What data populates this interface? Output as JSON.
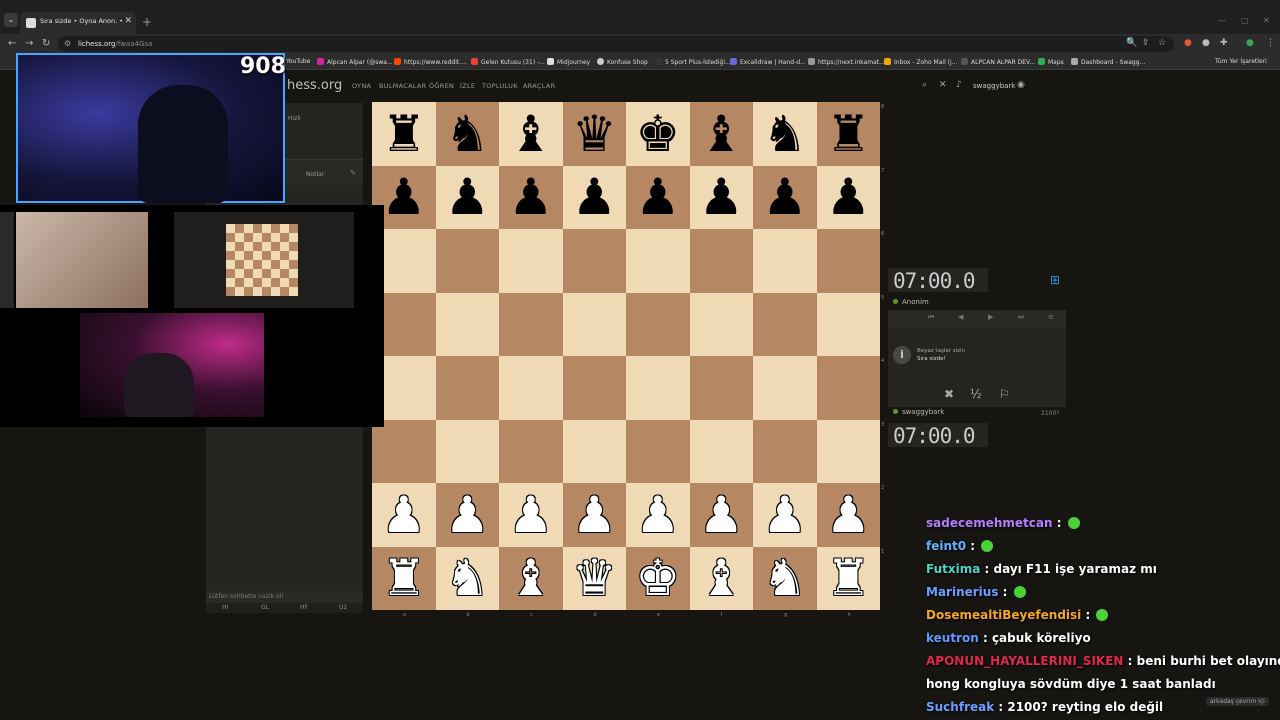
{
  "browser": {
    "tab_title": "Sıra sizde • Oyna Anon. • liches",
    "url_host": "lichess.org",
    "url_path": "/fwaa4Gsa",
    "bookmarks": [
      "YouTube",
      "Alpcan Alpar (@swa...",
      "https://www.reddit....",
      "Gelen Kutusu (31) -...",
      "Midjourney",
      "Konfuse Shop",
      "5 Sport Plus-İstediği...",
      "Excalidraw | Hand-d...",
      "https://next.inkamat...",
      "Inbox - Zoho Mail (j...",
      "ALPCAN ALPAR DEV...",
      "Maps",
      "Dashboard - Swagg..."
    ],
    "all_bookmarks": "Tüm Yer İşaretleri"
  },
  "site": {
    "logo": "hess.org",
    "nav": [
      "OYNA",
      "BULMACALAR",
      "ÖĞREN",
      "İZLE",
      "TOPLULUK",
      "ARAÇLAR"
    ],
    "username": "swaggybark",
    "mode_label": "Hızlı",
    "notes_label": "Notlar",
    "chat_placeholder": "Lütfen sohbette nazik ol!",
    "chat_presets": [
      "HI",
      "GL",
      "HF",
      "U2"
    ]
  },
  "board": {
    "rows": [
      [
        "♜",
        "♞",
        "♝",
        "♛",
        "♚",
        "♝",
        "♞",
        "♜"
      ],
      [
        "♟",
        "♟",
        "♟",
        "♟",
        "♟",
        "♟",
        "♟",
        "♟"
      ],
      [
        "",
        "",
        "",
        "",
        "",
        "",
        "",
        ""
      ],
      [
        "",
        "",
        "",
        "",
        "",
        "",
        "",
        ""
      ],
      [
        "",
        "",
        "",
        "",
        "",
        "",
        "",
        ""
      ],
      [
        "",
        "",
        "",
        "",
        "",
        "",
        "",
        ""
      ],
      [
        "♟",
        "♟",
        "♟",
        "♟",
        "♟",
        "♟",
        "♟",
        "♟"
      ],
      [
        "♜",
        "♞",
        "♝",
        "♛",
        "♚",
        "♝",
        "♞",
        "♜"
      ]
    ],
    "ranks": [
      "8",
      "7",
      "6",
      "5",
      "4",
      "3",
      "2",
      "1"
    ],
    "files": [
      "a",
      "b",
      "c",
      "d",
      "e",
      "f",
      "g",
      "h"
    ]
  },
  "game": {
    "top_clock": "07:00.0",
    "top_player": "Anonim",
    "bottom_clock": "07:00.0",
    "bottom_player": "swaggybark",
    "bottom_rating": "2100?",
    "message_line1": "Beyaz taşlar sizin",
    "message_line2": "Sıra sizde!",
    "draw_label": "½"
  },
  "stream": {
    "viewers": "908"
  },
  "chat": [
    {
      "user": "sadecemehmetcan",
      "color": "#b77dff",
      "text": "",
      "emote": true
    },
    {
      "user": "feint0",
      "color": "#5eb3ff",
      "text": "",
      "emote": true
    },
    {
      "user": "Futxima",
      "color": "#4fd1c5",
      "text": "dayı F11 işe yaramaz mı",
      "emote": false
    },
    {
      "user": "Marinerius",
      "color": "#6f9eff",
      "text": "",
      "emote": true
    },
    {
      "user": "DosemealtiBeyefendisi",
      "color": "#f5a623",
      "text": "",
      "emote": true
    },
    {
      "user": "keutron",
      "color": "#5e9bff",
      "text": "çabuk köreliyo",
      "emote": false
    },
    {
      "user": "APONUN_HAYALLERINI_SIKEN",
      "color": "#e0284e",
      "text": "beni burhi bet olayında",
      "emote": false
    },
    {
      "user": "",
      "color": "#ffffff",
      "text": "hong kongluya sövdüm diye 1 saat banladı",
      "emote": false
    },
    {
      "user": "Suchfreak",
      "color": "#6f9eff",
      "text": "2100? reyting elo değil",
      "emote": false
    }
  ],
  "friends_label": "arkadaş çevrim içi"
}
